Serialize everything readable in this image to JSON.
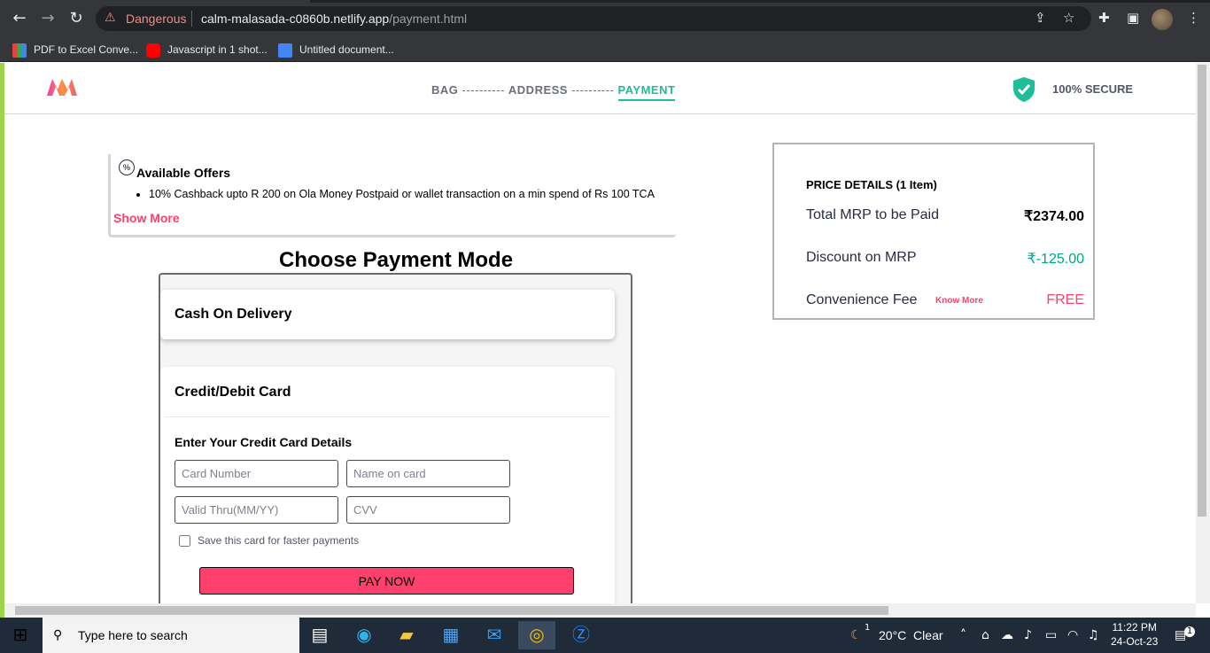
{
  "browser": {
    "security_label": "Dangerous",
    "url_host": "calm-malasada-c0860b.netlify.app",
    "url_path": "/payment.html",
    "bookmarks": [
      {
        "label": "PDF to Excel Conve..."
      },
      {
        "label": "Javascript in 1 shot..."
      },
      {
        "label": "Untitled document..."
      }
    ]
  },
  "header": {
    "steps": {
      "bag": "BAG",
      "sep1": " ---------- ",
      "address": "ADDRESS",
      "sep2": " ---------- ",
      "payment": "PAYMENT"
    },
    "secure_label": "100% SECURE"
  },
  "offers": {
    "title": "Available Offers",
    "items": [
      "10% Cashback upto R 200 on Ola Money Postpaid or wallet transaction on a min spend of Rs 100 TCA"
    ],
    "show_more": "Show More"
  },
  "payment": {
    "title": "Choose Payment Mode",
    "cod_label": "Cash On Delivery",
    "card_label": "Credit/Debit Card",
    "card_details_title": "Enter Your Credit Card Details",
    "placeholders": {
      "card_number": "Card Number",
      "name_on_card": "Name on card",
      "valid_thru": "Valid Thru(MM/YY)",
      "cvv": "CVV"
    },
    "save_card": "Save this card for faster payments",
    "pay_now": "PAY NOW"
  },
  "price_details": {
    "title": "PRICE DETAILS (1 Item)",
    "total_mrp_label": "Total MRP to be Paid",
    "total_mrp_value": "₹2374.00",
    "discount_label": "Discount on MRP",
    "discount_value": "₹-125.00",
    "fee_label": "Convenience Fee",
    "know_more": "Know More",
    "fee_value": "FREE"
  },
  "taskbar": {
    "search_placeholder": "Type here to search",
    "weather": "20°C  Clear",
    "weather_badge": "1",
    "time": "11:22 PM",
    "date": "24-Oct-23",
    "notification_count": "1"
  },
  "colors": {
    "brand_pink": "#ff3f6c",
    "accent_green": "#20bd99",
    "discount_green": "#03a685"
  }
}
